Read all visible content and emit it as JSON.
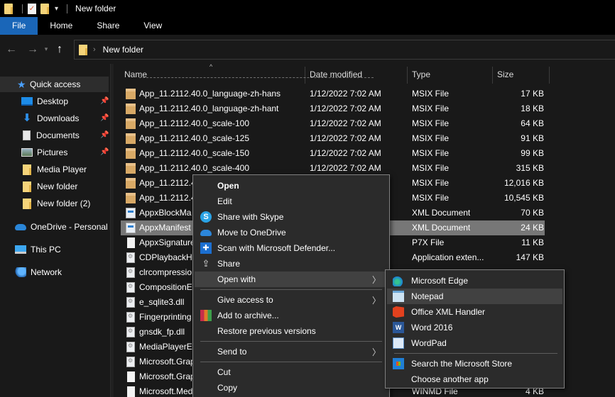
{
  "window": {
    "title": "New folder"
  },
  "ribbon": {
    "tabs": [
      "File",
      "Home",
      "Share",
      "View"
    ]
  },
  "address": {
    "path": "New folder"
  },
  "sidebar": {
    "quick_access": "Quick access",
    "items": [
      {
        "label": "Desktop",
        "pinned": true,
        "icon": "desktop-icon"
      },
      {
        "label": "Downloads",
        "pinned": true,
        "icon": "download-icon"
      },
      {
        "label": "Documents",
        "pinned": true,
        "icon": "documents-icon"
      },
      {
        "label": "Pictures",
        "pinned": true,
        "icon": "pictures-icon"
      },
      {
        "label": "Media Player",
        "pinned": false,
        "icon": "folder-icon"
      },
      {
        "label": "New folder",
        "pinned": false,
        "icon": "folder-icon"
      },
      {
        "label": "New folder (2)",
        "pinned": false,
        "icon": "folder-icon"
      }
    ],
    "onedrive": "OneDrive - Personal",
    "this_pc": "This PC",
    "network": "Network"
  },
  "columns": {
    "name": "Name",
    "date": "Date modified",
    "type": "Type",
    "size": "Size"
  },
  "files": [
    {
      "name": "App_11.2112.40.0_language-zh-hans",
      "date": "1/12/2022 7:02 AM",
      "type": "MSIX File",
      "size": "17 KB",
      "icon": "box"
    },
    {
      "name": "App_11.2112.40.0_language-zh-hant",
      "date": "1/12/2022 7:02 AM",
      "type": "MSIX File",
      "size": "18 KB",
      "icon": "box"
    },
    {
      "name": "App_11.2112.40.0_scale-100",
      "date": "1/12/2022 7:02 AM",
      "type": "MSIX File",
      "size": "64 KB",
      "icon": "box"
    },
    {
      "name": "App_11.2112.40.0_scale-125",
      "date": "1/12/2022 7:02 AM",
      "type": "MSIX File",
      "size": "91 KB",
      "icon": "box"
    },
    {
      "name": "App_11.2112.40.0_scale-150",
      "date": "1/12/2022 7:02 AM",
      "type": "MSIX File",
      "size": "99 KB",
      "icon": "box"
    },
    {
      "name": "App_11.2112.40.0_scale-400",
      "date": "1/12/2022 7:02 AM",
      "type": "MSIX File",
      "size": "315 KB",
      "icon": "box"
    },
    {
      "name": "App_11.2112.4",
      "date": "",
      "type": "MSIX File",
      "size": "12,016 KB",
      "icon": "box"
    },
    {
      "name": "App_11.2112.4",
      "date": "",
      "type": "MSIX File",
      "size": "10,545 KB",
      "icon": "box"
    },
    {
      "name": "AppxBlockMa",
      "date": "",
      "type": "XML Document",
      "size": "70 KB",
      "icon": "xml"
    },
    {
      "name": "AppxManifest",
      "date": "",
      "type": "XML Document",
      "size": "24 KB",
      "icon": "xml",
      "selected": true
    },
    {
      "name": "AppxSignature",
      "date": "",
      "type": "P7X File",
      "size": "11 KB",
      "icon": "blank"
    },
    {
      "name": "CDPlaybackHe",
      "date": "",
      "type": "Application exten...",
      "size": "147 KB",
      "icon": "dll"
    },
    {
      "name": "clrcompressio",
      "date": "",
      "type": "",
      "size": "",
      "icon": "dll"
    },
    {
      "name": "CompositionE",
      "date": "",
      "type": "",
      "size": "",
      "icon": "dll"
    },
    {
      "name": "e_sqlite3.dll",
      "date": "",
      "type": "",
      "size": "",
      "icon": "dll"
    },
    {
      "name": "Fingerprinting",
      "date": "",
      "type": "",
      "size": "",
      "icon": "dll"
    },
    {
      "name": "gnsdk_fp.dll",
      "date": "",
      "type": "",
      "size": "",
      "icon": "dll"
    },
    {
      "name": "MediaPlayerEf",
      "date": "",
      "type": "",
      "size": "",
      "icon": "dll"
    },
    {
      "name": "Microsoft.Grap",
      "date": "",
      "type": "",
      "size": "",
      "icon": "dll"
    },
    {
      "name": "Microsoft.Grap",
      "date": "",
      "type": "",
      "size": "",
      "icon": "blank"
    },
    {
      "name": "Microsoft.Med",
      "date": "",
      "type": "WINMD File",
      "size": "4 KB",
      "icon": "blank"
    }
  ],
  "context_menu": {
    "items": [
      {
        "label": "Open",
        "bold": true
      },
      {
        "label": "Edit"
      },
      {
        "label": "Share with Skype",
        "icon": "skype"
      },
      {
        "label": "Move to OneDrive",
        "icon": "onedrive"
      },
      {
        "label": "Scan with Microsoft Defender...",
        "icon": "defender"
      },
      {
        "label": "Share",
        "icon": "share"
      },
      {
        "label": "Open with",
        "submenu": true,
        "hover": true
      },
      {
        "sep": true
      },
      {
        "label": "Give access to",
        "submenu": true
      },
      {
        "label": "Add to archive...",
        "icon": "rar"
      },
      {
        "label": "Restore previous versions"
      },
      {
        "sep": true
      },
      {
        "label": "Send to",
        "submenu": true
      },
      {
        "sep": true
      },
      {
        "label": "Cut"
      },
      {
        "label": "Copy"
      }
    ]
  },
  "open_with": {
    "items": [
      {
        "label": "Microsoft Edge",
        "icon": "edge"
      },
      {
        "label": "Notepad",
        "icon": "notepad",
        "hover": true
      },
      {
        "label": "Office XML Handler",
        "icon": "office"
      },
      {
        "label": "Word 2016",
        "icon": "word"
      },
      {
        "label": "WordPad",
        "icon": "wordpad"
      },
      {
        "sep": true
      },
      {
        "label": "Search the Microsoft Store",
        "icon": "store"
      },
      {
        "label": "Choose another app"
      }
    ]
  }
}
